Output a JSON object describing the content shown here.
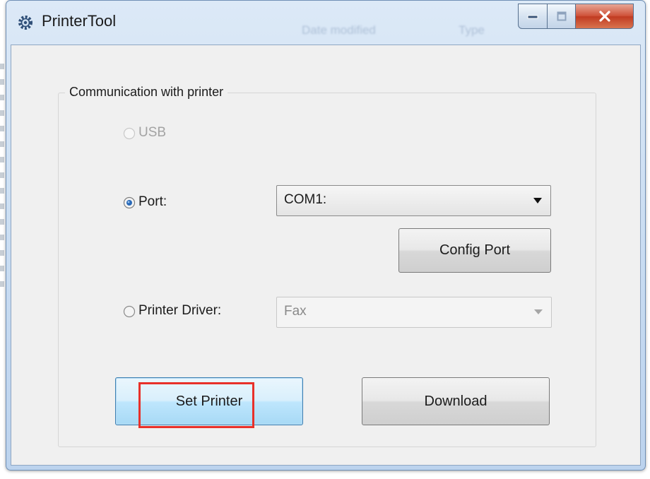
{
  "window": {
    "title": "PrinterTool",
    "background_ghost_texts": [
      "Date modified",
      "Type"
    ],
    "controls": {
      "minimize": "minimize",
      "maximize": "maximize",
      "close": "X"
    }
  },
  "group": {
    "legend": "Communication with printer",
    "options": [
      {
        "label": "USB",
        "selected": false,
        "enabled": false
      },
      {
        "label": "Port:",
        "selected": true,
        "enabled": true
      },
      {
        "label": "Printer Driver:",
        "selected": false,
        "enabled": true
      }
    ],
    "port_select": {
      "value": "COM1:",
      "enabled": true
    },
    "driver_select": {
      "value": "Fax",
      "enabled": false
    },
    "config_port_label": "Config Port"
  },
  "buttons": {
    "set_printer": "Set Printer",
    "download": "Download"
  },
  "colors": {
    "highlight": "#e8302a",
    "default_button_border": "#3c7fb1",
    "radio_selected": "#2a6ab8"
  },
  "icons": {
    "app": "gear-icon",
    "minimize": "minimize-icon",
    "maximize": "maximize-icon",
    "close": "close-icon",
    "dropdown": "chevron-down-icon"
  }
}
